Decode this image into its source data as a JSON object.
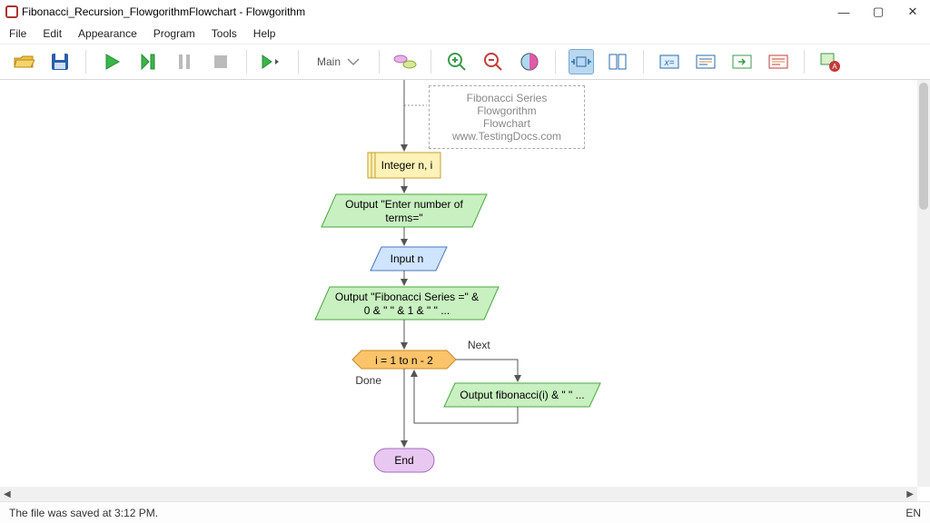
{
  "window": {
    "title": "Fibonacci_Recursion_FlowgorithmFlowchart - Flowgorithm"
  },
  "win_controls": {
    "min": "—",
    "max": "▢",
    "close": "✕"
  },
  "menu": {
    "file": "File",
    "edit": "Edit",
    "appearance": "Appearance",
    "program": "Program",
    "tools": "Tools",
    "help": "Help"
  },
  "func": {
    "label": "Main"
  },
  "comment": {
    "line1": "Fibonacci Series Flowgorithm",
    "line2": "Flowchart",
    "line3": "www.TestingDocs.com"
  },
  "flow": {
    "declare": "Integer n, i",
    "out_prompt1": "Output \"Enter number of",
    "out_prompt2": "terms=\"",
    "input": "Input n",
    "out_series1": "Output \"Fibonacci Series =\" &",
    "out_series2": "0 & \" \" & 1 & \" \" ...",
    "for": "i = 1 to n - 2",
    "next": "Next",
    "done": "Done",
    "out_fib": "Output fibonacci(i) & \" \" ...",
    "end": "End"
  },
  "status": {
    "message": "The file was saved at 3:12 PM.",
    "lang": "EN"
  },
  "chart_data": {
    "type": "diagram",
    "title": "Fibonacci Series Flowgorithm Flowchart",
    "nodes": [
      {
        "id": "declare",
        "shape": "process",
        "text": "Integer n, i"
      },
      {
        "id": "out_prompt",
        "shape": "output",
        "text": "Output \"Enter number of terms=\""
      },
      {
        "id": "input_n",
        "shape": "input",
        "text": "Input n"
      },
      {
        "id": "out_series",
        "shape": "output",
        "text": "Output \"Fibonacci Series =\" & 0 & \" \" & 1 & \" \" ..."
      },
      {
        "id": "for_loop",
        "shape": "hexagon",
        "text": "i = 1 to n - 2"
      },
      {
        "id": "out_fib",
        "shape": "output",
        "text": "Output fibonacci(i) & \" \" ..."
      },
      {
        "id": "end",
        "shape": "terminator",
        "text": "End"
      }
    ],
    "edges": [
      {
        "from": "declare",
        "to": "out_prompt"
      },
      {
        "from": "out_prompt",
        "to": "input_n"
      },
      {
        "from": "input_n",
        "to": "out_series"
      },
      {
        "from": "out_series",
        "to": "for_loop"
      },
      {
        "from": "for_loop",
        "to": "out_fib",
        "label": "Next"
      },
      {
        "from": "out_fib",
        "to": "for_loop"
      },
      {
        "from": "for_loop",
        "to": "end",
        "label": "Done"
      }
    ]
  }
}
